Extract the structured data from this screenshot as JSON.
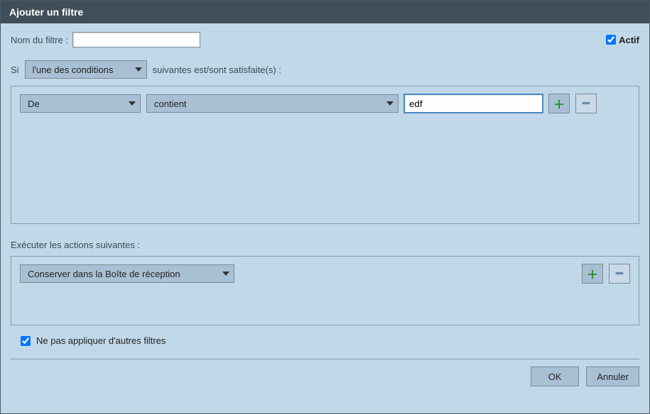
{
  "dialog": {
    "title": "Ajouter un filtre"
  },
  "filter": {
    "name_label": "Nom du filtre :",
    "name_value": "",
    "active_label": "Actif",
    "active_checked": true
  },
  "condition_sentence": {
    "prefix": "Si",
    "match_mode": "l'une des conditions",
    "suffix": "suivantes est/sont satisfaite(s) :"
  },
  "conditions": [
    {
      "field": "De",
      "operator": "contient",
      "value": "edf"
    }
  ],
  "actions_label": "Exécuter les actions suivantes :",
  "actions": [
    {
      "type": "Conserver dans la Boîte de réception"
    }
  ],
  "no_other_filters": {
    "label": "Ne pas appliquer d'autres filtres",
    "checked": true
  },
  "footer": {
    "ok": "OK",
    "cancel": "Annuler"
  }
}
